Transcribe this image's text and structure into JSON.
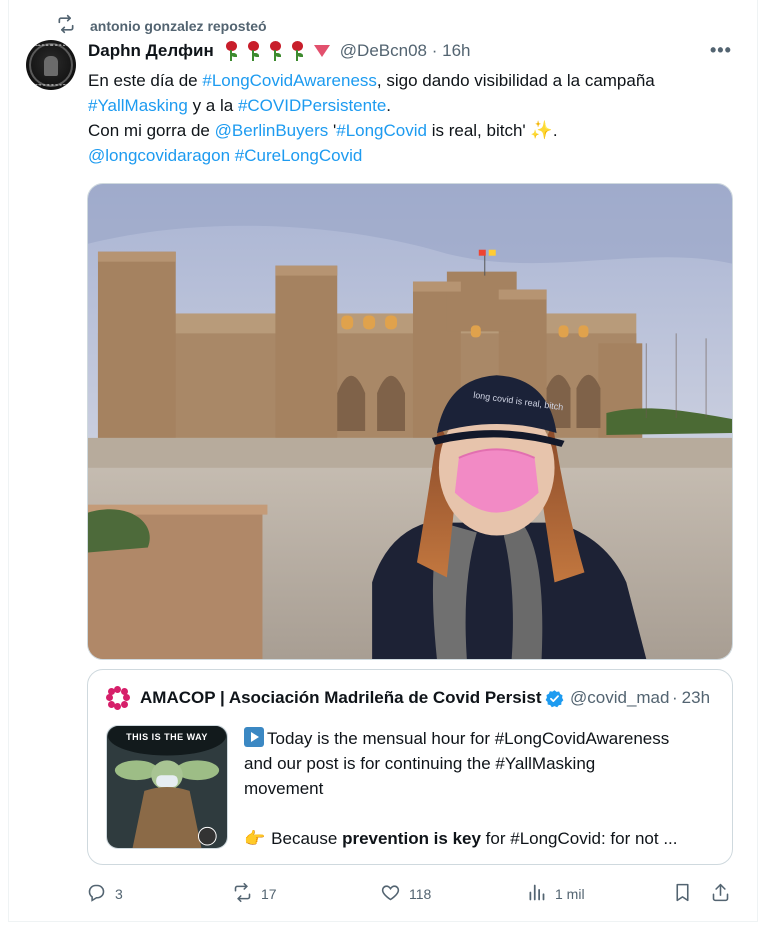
{
  "repost": {
    "label": "antonio gonzalez reposteó",
    "icon": "repost-icon"
  },
  "post": {
    "display_name": "Daphn Делфин",
    "handle": "@DeBcn08",
    "separator": "·",
    "time": "16h",
    "more_icon": "more-icon",
    "text": {
      "l1_a": "En este día de ",
      "l1_link": "#LongCovidAwareness",
      "l1_b": ", sigo dando visibilidad a la campaña",
      "l2_link1": "#YallMasking",
      "l2_a": " y a la ",
      "l2_link2": "#COVIDPersistente",
      "l2_b": ".",
      "l3_a": "Con mi gorra de ",
      "l3_link1": "@BerlinBuyers",
      "l3_b": " '",
      "l3_link2": "#LongCovid",
      "l3_c": " is real, bitch' ",
      "l3_emoji": "✨",
      "l3_d": ".",
      "l4_link1": "@longcovidaragon",
      "l4_link2": "#CureLongCovid"
    },
    "media": {
      "cap_text": "long covid is real, bitch"
    }
  },
  "quote": {
    "name": "AMACOP | Asociación Madrileña de Covid Persistente",
    "handle": "@covid_madrid",
    "separator": "·",
    "time": "23h",
    "thumb_caption": "THIS IS THE WAY",
    "line1": "Today is the mensual hour for #LongCovidAwareness",
    "line2": "and our post is for continuing the #YallMasking",
    "line3": "movement",
    "line5_a": "Because ",
    "line5_bold": "prevention is key",
    "line5_b": " for #LongCovid: for not ...",
    "emoji_play": "play-button-icon",
    "emoji_hand": "👉"
  },
  "actions": {
    "replies": "3",
    "reposts": "17",
    "likes": "118",
    "views": "1 mil"
  },
  "colors": {
    "link": "#1d9bf0",
    "muted": "#536471",
    "text": "#0f1419",
    "border": "#cfd9de"
  }
}
